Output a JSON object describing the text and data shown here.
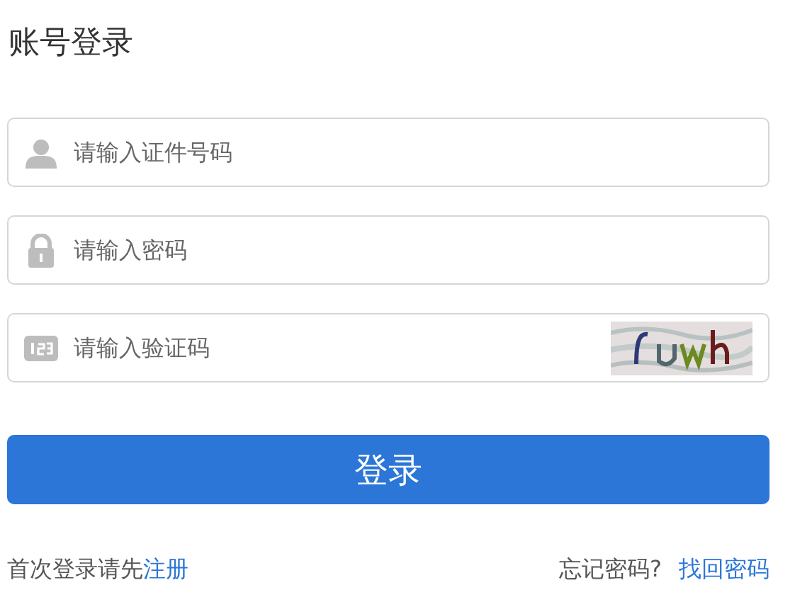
{
  "title": "账号登录",
  "fields": [
    {
      "kind": "user",
      "placeholder": "请输入证件号码"
    },
    {
      "kind": "lock",
      "placeholder": "请输入密码"
    },
    {
      "kind": "code",
      "placeholder": "请输入验证码"
    }
  ],
  "login_button": "登录",
  "footer": {
    "register_prompt": "首次登录请先",
    "register_link": "注册",
    "forgot_prompt": "忘记密码?",
    "recover_link": "找回密码"
  }
}
